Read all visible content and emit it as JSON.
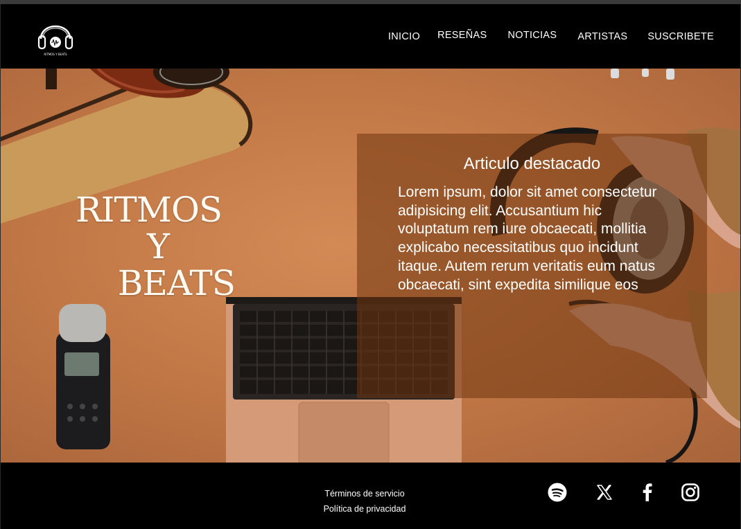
{
  "header": {
    "logo_icon": "headphones-logo-icon",
    "logo_text": "RITMOS Y BEATS",
    "nav": [
      {
        "label": "INICIO"
      },
      {
        "label": "RESEÑAS"
      },
      {
        "label": "NOTICIAS"
      },
      {
        "label": "ARTISTAS"
      },
      {
        "label": "SUSCRIBETE"
      }
    ]
  },
  "hero": {
    "title_lines": [
      "RITMOS",
      "Y",
      "BEATS"
    ],
    "featured": {
      "heading": "Articulo destacado",
      "body": "Lorem ipsum, dolor sit amet consectetur adipisicing elit. Accusantium hic voluptatum rem iure obcaecati, mollitia explicabo necessitatibus quo incidunt itaque. Autem rerum veritatis eum natus obcaecati, sint expedita similique eos"
    }
  },
  "footer": {
    "terms": "Términos de servicio",
    "privacy": "Política de privacidad",
    "social": [
      {
        "icon": "spotify-icon"
      },
      {
        "icon": "x-twitter-icon"
      },
      {
        "icon": "facebook-icon"
      },
      {
        "icon": "instagram-icon"
      }
    ]
  },
  "colors": {
    "header_bg": "#000000",
    "hero_bg": "#c47a47",
    "overlay": "#70340e",
    "text": "#ffffff"
  }
}
